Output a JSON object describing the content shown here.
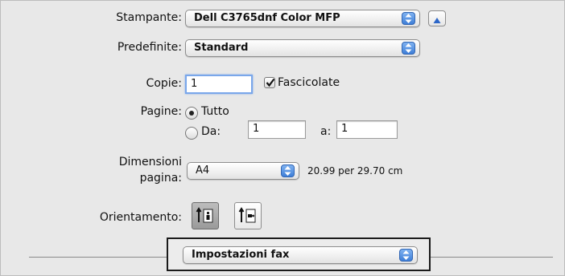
{
  "printer": {
    "label": "Stampante:",
    "value": "Dell C3765dnf Color MFP"
  },
  "presets": {
    "label": "Predefinite:",
    "value": "Standard"
  },
  "copies": {
    "label": "Copie:",
    "value": "1",
    "collate_label": "Fascicolate",
    "collate_checked": true
  },
  "pages": {
    "label": "Pagine:",
    "all_label": "Tutto",
    "all_selected": true,
    "from_label": "Da:",
    "from_value": "1",
    "to_label": "a:",
    "to_value": "1"
  },
  "paper_size": {
    "label_line1": "Dimensioni",
    "label_line2": "pagina:",
    "value": "A4",
    "dimensions": "20.99 per 29.70 cm"
  },
  "orientation": {
    "label": "Orientamento:",
    "options": [
      "portrait",
      "landscape"
    ],
    "selected": "portrait"
  },
  "section": {
    "value": "Impostazioni fax"
  },
  "icons": {
    "popup_arrows": "up-down-arrows-icon",
    "expand": "disclosure-triangle-up-icon",
    "portrait": "portrait-orientation-icon",
    "landscape": "landscape-orientation-icon",
    "checkbox": "checkmark-icon"
  },
  "colors": {
    "accent": "#4a86dc",
    "background": "#e8e8e8"
  }
}
